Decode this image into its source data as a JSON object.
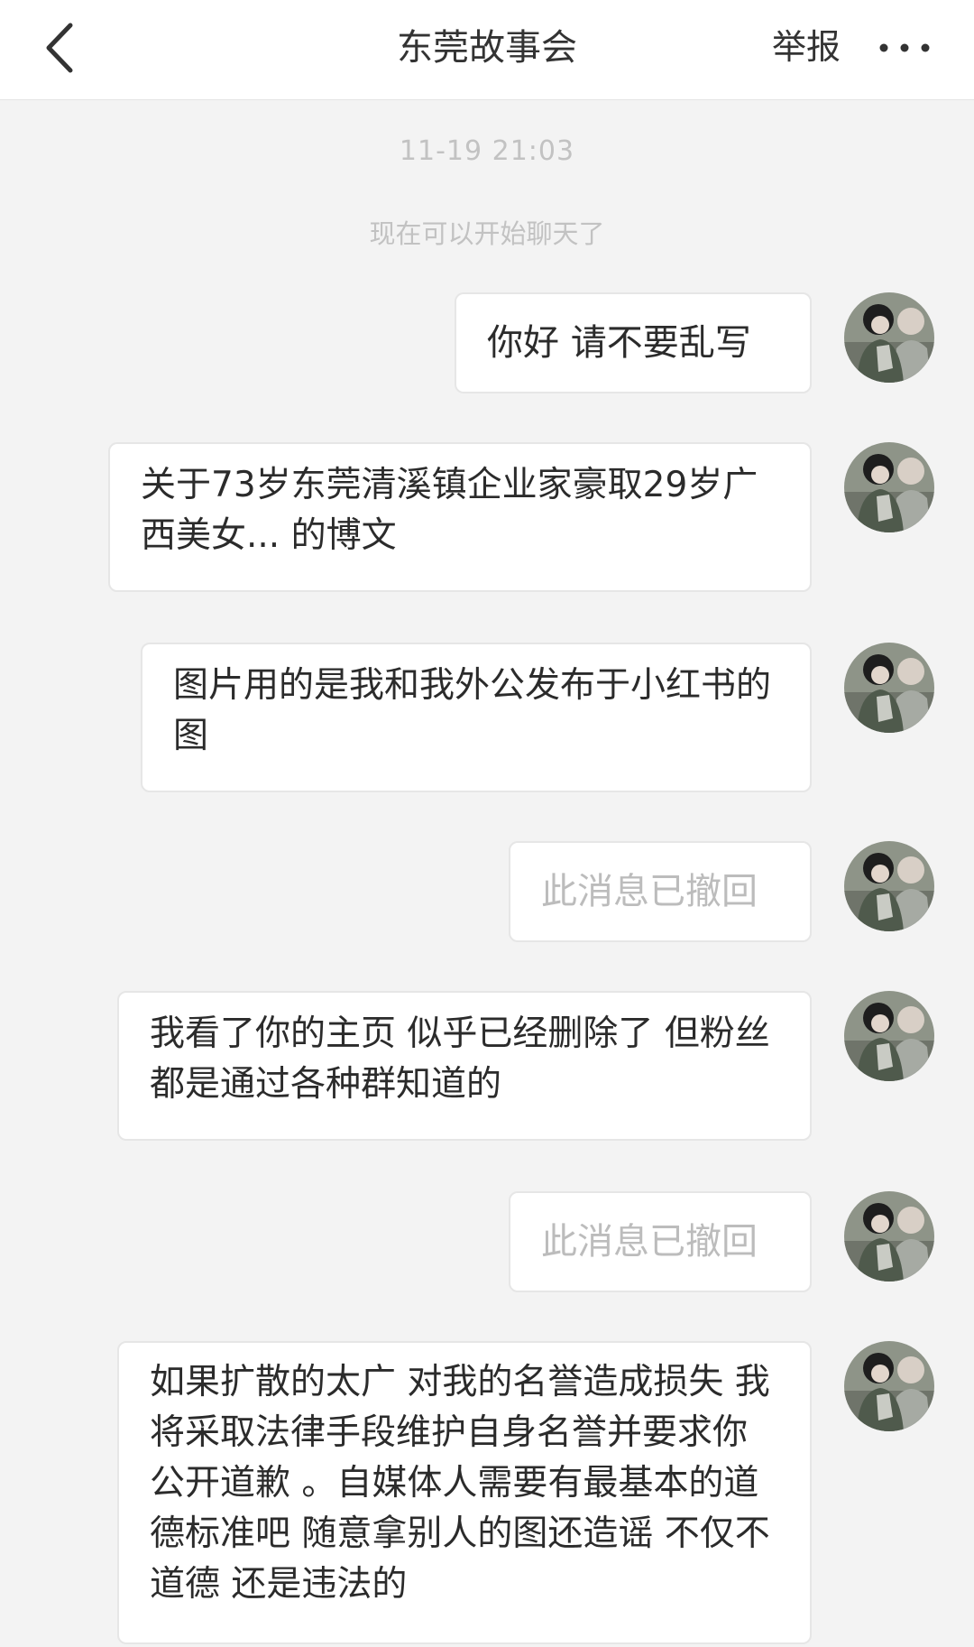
{
  "header": {
    "title": "东莞故事会",
    "report_label": "举报",
    "back_icon": "chevron-left-icon",
    "more_icon": "more-dots-icon"
  },
  "chat": {
    "timestamp": "11-19 21:03",
    "system_note": "现在可以开始聊天了",
    "messages": [
      {
        "text": "你好 请不要乱写",
        "sender": "self",
        "recalled": false
      },
      {
        "text": "关于73岁东莞清溪镇企业家豪取29岁广西美女... 的博文",
        "sender": "self",
        "recalled": false
      },
      {
        "text": "图片用的是我和我外公发布于小红书的图",
        "sender": "self",
        "recalled": false
      },
      {
        "text": "此消息已撤回",
        "sender": "self",
        "recalled": true
      },
      {
        "text": "我看了你的主页 似乎已经删除了 但粉丝都是通过各种群知道的",
        "sender": "self",
        "recalled": false
      },
      {
        "text": "此消息已撤回",
        "sender": "self",
        "recalled": true
      },
      {
        "text": "如果扩散的太广 对我的名誉造成损失 我将采取法律手段维护自身名誉并要求你公开道歉 。自媒体人需要有最基本的道德标准吧 随意拿别人的图还造谣 不仅不道德 还是违法的",
        "sender": "self",
        "recalled": false
      }
    ]
  },
  "colors": {
    "background": "#f3f3f3",
    "bubble": "#ffffff",
    "bubble_border": "#e6e6e6",
    "text": "#2b2b2b",
    "muted": "#c2c2c2",
    "recalled_text": "#bcbcbc"
  }
}
